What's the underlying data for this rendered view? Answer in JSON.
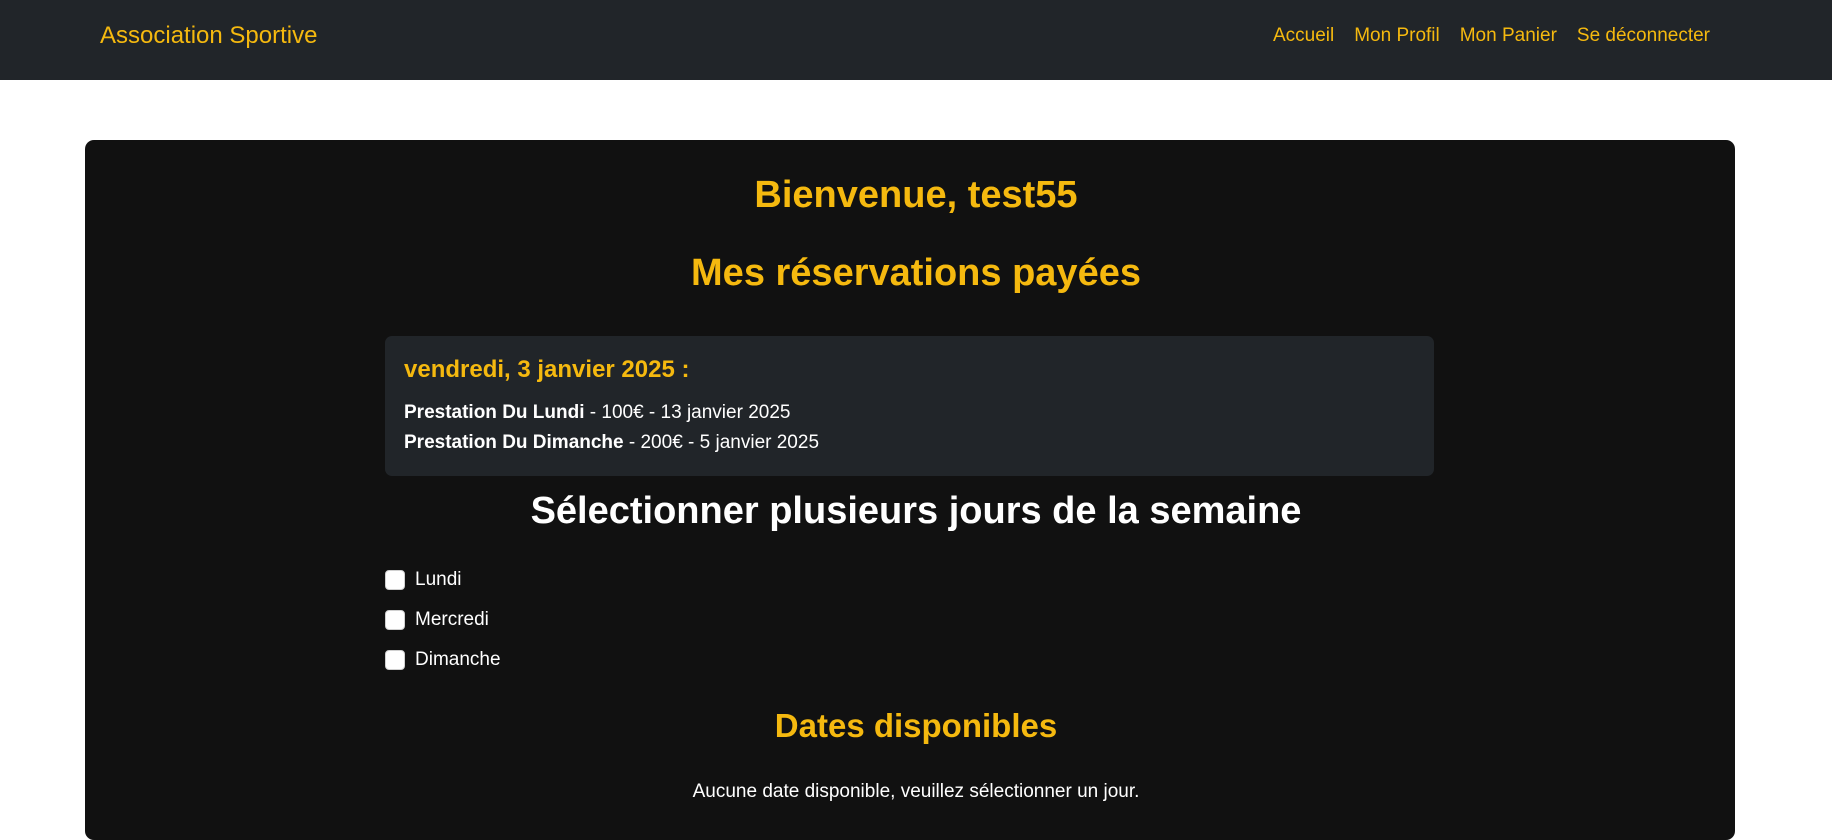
{
  "navbar": {
    "brand": "Association Sportive",
    "links": [
      "Accueil",
      "Mon Profil",
      "Mon Panier",
      "Se déconnecter"
    ]
  },
  "main": {
    "welcome": "Bienvenue, test55",
    "reservations_title": "Mes réservations payées",
    "reservation_group": {
      "date": "vendredi, 3 janvier 2025 :",
      "items": [
        {
          "name": "Prestation Du Lundi",
          "details": " - 100€ - 13 janvier 2025"
        },
        {
          "name": "Prestation Du Dimanche",
          "details": " - 200€ - 5 janvier 2025"
        }
      ]
    },
    "select_days_title": "Sélectionner plusieurs jours de la semaine",
    "days": [
      "Lundi",
      "Mercredi",
      "Dimanche"
    ],
    "available_dates_title": "Dates disponibles",
    "no_dates_message": "Aucune date disponible, veuillez sélectionner un jour."
  },
  "colors": {
    "navbar_bg": "#212529",
    "accent": "#f5b90f",
    "card_bg": "#111111",
    "box_bg": "#212529"
  }
}
